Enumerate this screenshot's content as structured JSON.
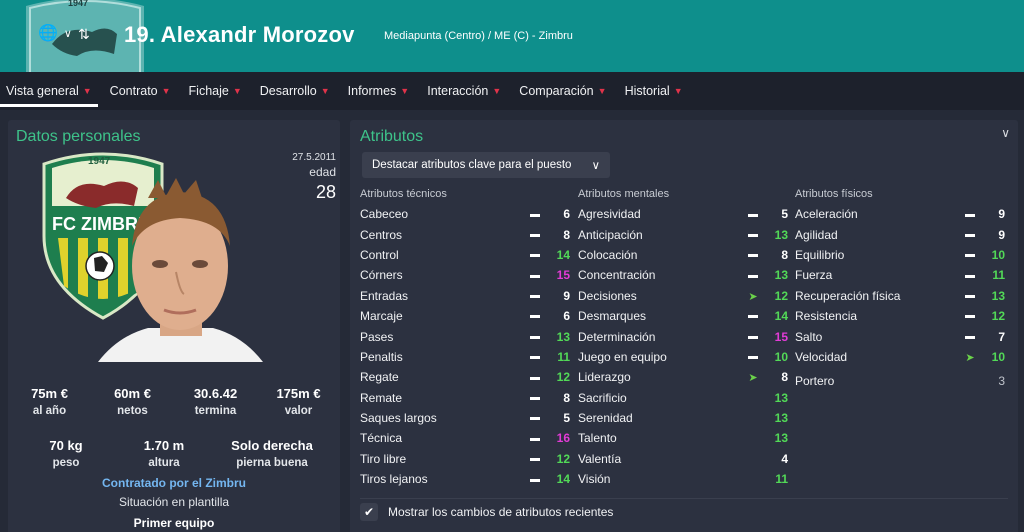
{
  "header": {
    "player_name": "19. Alexandr Morozov",
    "subtitle": "Mediapunta (Centro) / ME (C) - Zimbru",
    "icons": [
      "globe-icon",
      "chevron-down-icon",
      "up-down-arrows-icon"
    ]
  },
  "nav": {
    "tabs": [
      {
        "label": "Vista general",
        "active": true
      },
      {
        "label": "Contrato"
      },
      {
        "label": "Fichaje"
      },
      {
        "label": "Desarrollo"
      },
      {
        "label": "Informes"
      },
      {
        "label": "Interacción"
      },
      {
        "label": "Comparación"
      },
      {
        "label": "Historial"
      }
    ]
  },
  "personal": {
    "title": "Datos personales",
    "dob": "27.5.2011",
    "age_label": "edad",
    "age": "28",
    "crest_text": "FC ZIMBRU",
    "crest_year": "1947",
    "stats1": [
      {
        "value": "75m €",
        "label": "al año"
      },
      {
        "value": "60m €",
        "label": "netos"
      },
      {
        "value": "30.6.42",
        "label": "termina"
      },
      {
        "value": "175m €",
        "label": "valor"
      }
    ],
    "stats2": [
      {
        "value": "70 kg",
        "label": "peso"
      },
      {
        "value": "1.70 m",
        "label": "altura"
      },
      {
        "value": "Solo derecha",
        "label": "pierna buena"
      }
    ],
    "contract_link": "Contratado por el Zimbru",
    "squad_label": "Situación en plantilla",
    "squad_value": "Primer equipo"
  },
  "attributes": {
    "title": "Atributos",
    "highlight_select": "Destacar atributos clave para el puesto",
    "technical": {
      "heading": "Atributos técnicos",
      "items": [
        {
          "name": "Cabeceo",
          "trend": "dash",
          "value": "6",
          "tone": "white"
        },
        {
          "name": "Centros",
          "trend": "dash",
          "value": "8",
          "tone": "white"
        },
        {
          "name": "Control",
          "trend": "dash",
          "value": "14",
          "tone": "green"
        },
        {
          "name": "Córners",
          "trend": "dash",
          "value": "15",
          "tone": "pink"
        },
        {
          "name": "Entradas",
          "trend": "dash",
          "value": "9",
          "tone": "white"
        },
        {
          "name": "Marcaje",
          "trend": "dash",
          "value": "6",
          "tone": "white"
        },
        {
          "name": "Pases",
          "trend": "dash",
          "value": "13",
          "tone": "green"
        },
        {
          "name": "Penaltis",
          "trend": "dash",
          "value": "11",
          "tone": "green"
        },
        {
          "name": "Regate",
          "trend": "dash",
          "value": "12",
          "tone": "green"
        },
        {
          "name": "Remate",
          "trend": "dash",
          "value": "8",
          "tone": "white"
        },
        {
          "name": "Saques largos",
          "trend": "dash",
          "value": "5",
          "tone": "white"
        },
        {
          "name": "Técnica",
          "trend": "dash",
          "value": "16",
          "tone": "pink"
        },
        {
          "name": "Tiro libre",
          "trend": "dash",
          "value": "12",
          "tone": "green"
        },
        {
          "name": "Tiros lejanos",
          "trend": "dash",
          "value": "14",
          "tone": "green"
        }
      ]
    },
    "mental": {
      "heading": "Atributos mentales",
      "items": [
        {
          "name": "Agresividad",
          "trend": "dash",
          "value": "5",
          "tone": "white"
        },
        {
          "name": "Anticipación",
          "trend": "dash",
          "value": "13",
          "tone": "green"
        },
        {
          "name": "Colocación",
          "trend": "dash",
          "value": "8",
          "tone": "white"
        },
        {
          "name": "Concentración",
          "trend": "dash",
          "value": "13",
          "tone": "green"
        },
        {
          "name": "Decisiones",
          "trend": "up",
          "value": "12",
          "tone": "green"
        },
        {
          "name": "Desmarques",
          "trend": "dash",
          "value": "14",
          "tone": "green"
        },
        {
          "name": "Determinación",
          "trend": "dash",
          "value": "15",
          "tone": "pink"
        },
        {
          "name": "Juego en equipo",
          "trend": "dash",
          "value": "10",
          "tone": "green"
        },
        {
          "name": "Liderazgo",
          "trend": "up",
          "value": "8",
          "tone": "white"
        },
        {
          "name": "Sacrificio",
          "trend": "none",
          "value": "13",
          "tone": "green"
        },
        {
          "name": "Serenidad",
          "trend": "none",
          "value": "13",
          "tone": "green"
        },
        {
          "name": "Talento",
          "trend": "none",
          "value": "13",
          "tone": "green"
        },
        {
          "name": "Valentía",
          "trend": "none",
          "value": "4",
          "tone": "white"
        },
        {
          "name": "Visión",
          "trend": "none",
          "value": "11",
          "tone": "green"
        }
      ]
    },
    "physical": {
      "heading": "Atributos físicos",
      "items": [
        {
          "name": "Aceleración",
          "trend": "dash",
          "value": "9",
          "tone": "white"
        },
        {
          "name": "Agilidad",
          "trend": "dash",
          "value": "9",
          "tone": "white"
        },
        {
          "name": "Equilibrio",
          "trend": "dash",
          "value": "10",
          "tone": "green"
        },
        {
          "name": "Fuerza",
          "trend": "dash",
          "value": "11",
          "tone": "green"
        },
        {
          "name": "Recuperación física",
          "trend": "dash",
          "value": "13",
          "tone": "green"
        },
        {
          "name": "Resistencia",
          "trend": "dash",
          "value": "12",
          "tone": "green"
        },
        {
          "name": "Salto",
          "trend": "dash",
          "value": "7",
          "tone": "white"
        },
        {
          "name": "Velocidad",
          "trend": "up",
          "value": "10",
          "tone": "green"
        }
      ],
      "extra": {
        "name": "Portero",
        "value": "3"
      }
    },
    "show_changes_label": "Mostrar los cambios de atributos recientes",
    "show_changes_checked": true
  },
  "colors": {
    "header": "#0e8f8c",
    "accent_green": "#3ec38a",
    "nav_chevron": "#e0334a",
    "value_green": "#52d957",
    "value_pink": "#e33bd7"
  }
}
